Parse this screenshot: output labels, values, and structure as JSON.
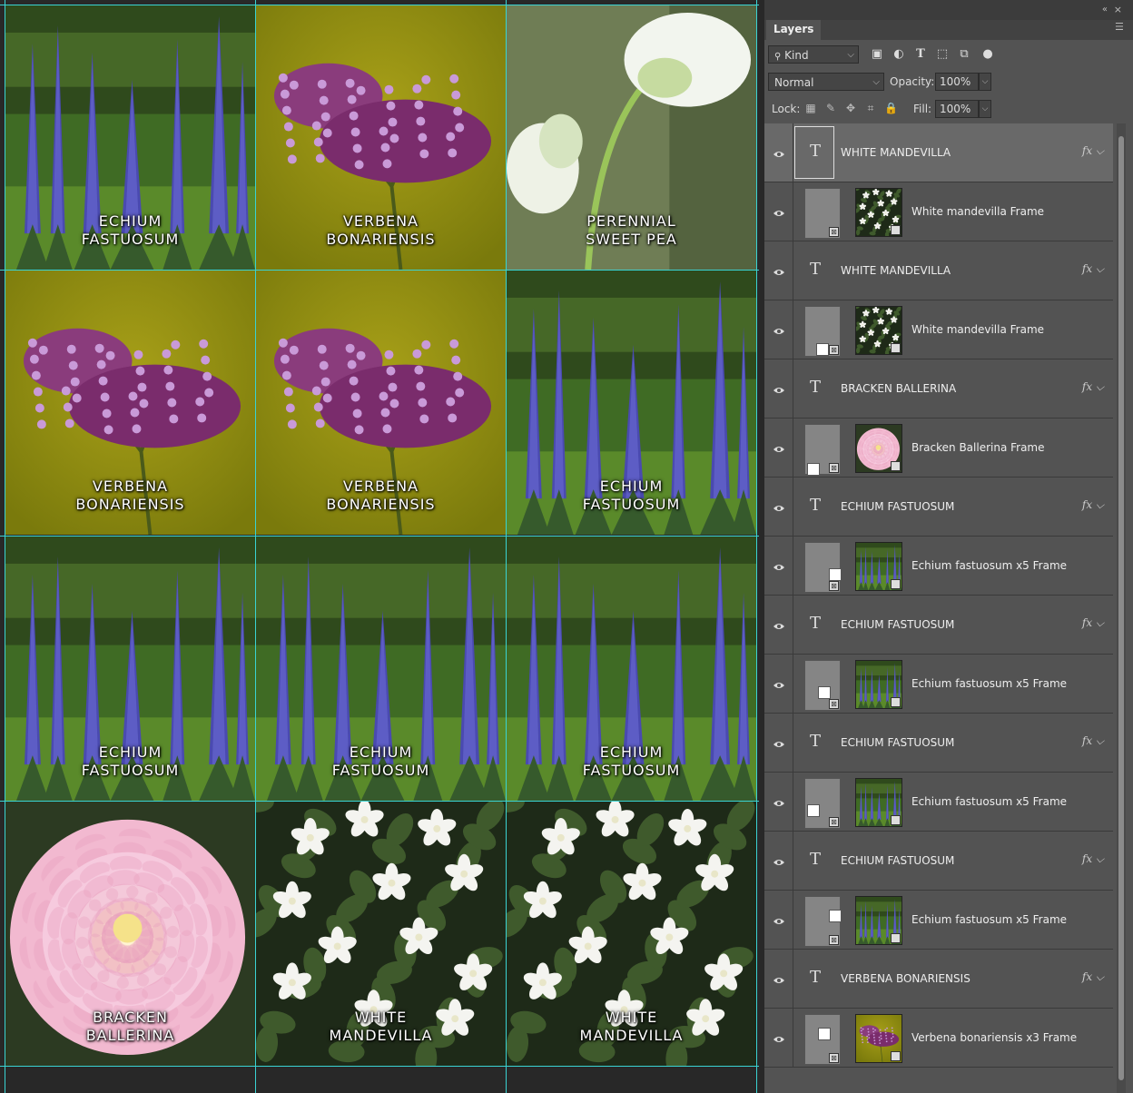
{
  "canvas": {
    "tiles": [
      {
        "name": "tile-echium-1",
        "kind": "echium",
        "caption": [
          "ECHIUM",
          "FASTUOSUM"
        ]
      },
      {
        "name": "tile-verbena-1",
        "kind": "verbena",
        "caption": [
          "VERBENA",
          "BONARIENSIS"
        ]
      },
      {
        "name": "tile-sweetpea",
        "kind": "sweetpea",
        "caption": [
          "PERENNIAL",
          "SWEET PEA"
        ]
      },
      {
        "name": "tile-verbena-2",
        "kind": "verbena",
        "caption": [
          "VERBENA",
          "BONARIENSIS"
        ]
      },
      {
        "name": "tile-verbena-3",
        "kind": "verbena",
        "caption": [
          "VERBENA",
          "BONARIENSIS"
        ]
      },
      {
        "name": "tile-echium-2",
        "kind": "echium",
        "caption": [
          "ECHIUM",
          "FASTUOSUM"
        ]
      },
      {
        "name": "tile-echium-3",
        "kind": "echium",
        "caption": [
          "ECHIUM",
          "FASTUOSUM"
        ]
      },
      {
        "name": "tile-echium-4",
        "kind": "echium",
        "caption": [
          "ECHIUM",
          "FASTUOSUM"
        ]
      },
      {
        "name": "tile-echium-5",
        "kind": "echium",
        "caption": [
          "ECHIUM",
          "FASTUOSUM"
        ]
      },
      {
        "name": "tile-bracken",
        "kind": "dahlia",
        "caption": [
          "BRACKEN",
          "BALLERINA"
        ]
      },
      {
        "name": "tile-mandevilla-1",
        "kind": "mandevilla",
        "caption": [
          "WHITE",
          "MANDEVILLA"
        ]
      },
      {
        "name": "tile-mandevilla-2",
        "kind": "mandevilla",
        "caption": [
          "WHITE",
          "MANDEVILLA"
        ]
      }
    ]
  },
  "panel": {
    "tab": "Layers",
    "collapse_glyph": "«",
    "close_glyph": "×",
    "filter": {
      "kind_label": "Kind"
    },
    "blend_mode": "Normal",
    "opacity_label": "Opacity:",
    "opacity_value": "100%",
    "lock_label": "Lock:",
    "fill_label": "Fill:",
    "fill_value": "100%",
    "layers": [
      {
        "type": "text",
        "name": "WHITE MANDEVILLA",
        "fx": "fx",
        "selected": true
      },
      {
        "type": "frame",
        "name": "White mandevilla Frame",
        "thumb": "mandevilla",
        "mask_square": null
      },
      {
        "type": "text",
        "name": "WHITE MANDEVILLA",
        "fx": "fx"
      },
      {
        "type": "frame",
        "name": "White mandevilla Frame",
        "thumb": "mandevilla",
        "mask_square": "bottom-left-mid"
      },
      {
        "type": "text",
        "name": "BRACKEN BALLERINA",
        "fx": "fx"
      },
      {
        "type": "frame",
        "name": "Bracken Ballerina Frame",
        "thumb": "dahlia",
        "mask_square": "bottom-left"
      },
      {
        "type": "text",
        "name": "ECHIUM FASTUOSUM",
        "fx": "fx"
      },
      {
        "type": "frame",
        "name": "Echium fastuosum x5 Frame",
        "thumb": "echium",
        "mask_square": "mid-right"
      },
      {
        "type": "text",
        "name": "ECHIUM FASTUOSUM",
        "fx": "fx"
      },
      {
        "type": "frame",
        "name": "Echium fastuosum x5 Frame",
        "thumb": "echium",
        "mask_square": "mid-center"
      },
      {
        "type": "text",
        "name": "ECHIUM FASTUOSUM",
        "fx": "fx"
      },
      {
        "type": "frame",
        "name": "Echium fastuosum x5 Frame",
        "thumb": "echium",
        "mask_square": "mid-left"
      },
      {
        "type": "text",
        "name": "ECHIUM FASTUOSUM",
        "fx": "fx"
      },
      {
        "type": "frame",
        "name": "Echium fastuosum x5 Frame",
        "thumb": "echium",
        "mask_square": "top-right"
      },
      {
        "type": "text",
        "name": "VERBENA BONARIENSIS",
        "fx": "fx"
      },
      {
        "type": "frame",
        "name": "Verbena bonariensis x3 Frame",
        "thumb": "verbena",
        "mask_square": "top-center"
      }
    ]
  },
  "colors": {
    "guide": "#3ad3d3",
    "panel_bg": "#535353",
    "selected_row": "#696969"
  }
}
